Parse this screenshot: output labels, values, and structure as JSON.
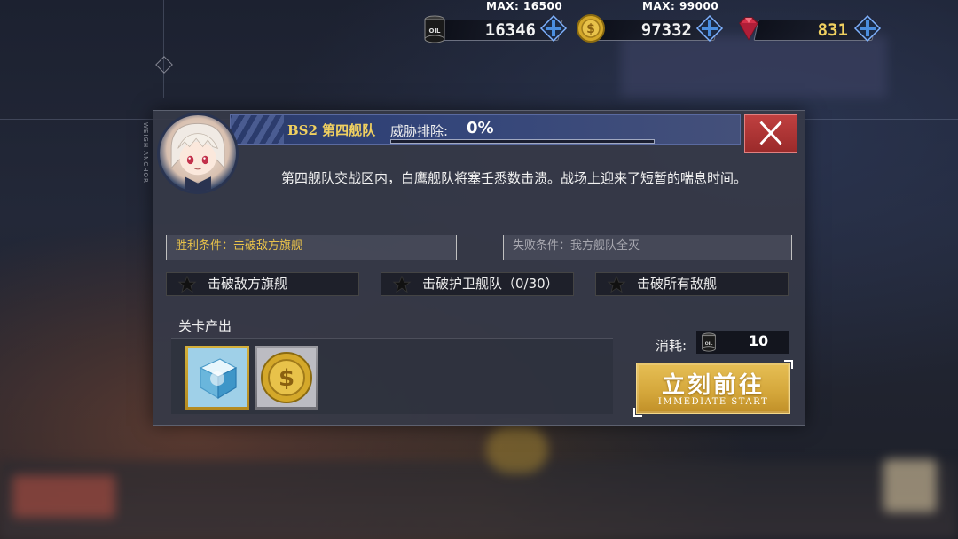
{
  "resources": {
    "oil": {
      "icon": "oil-barrel-icon",
      "value": "16346",
      "max": "MAX: 16500"
    },
    "gold": {
      "icon": "gold-coin-icon",
      "value": "97332",
      "max": "MAX: 99000"
    },
    "gems": {
      "icon": "gem-icon",
      "value": "831"
    }
  },
  "side_label": "WEIGH ANCHOR",
  "stage": {
    "title": "BS2 第四舰队",
    "threat_label": "威胁排除:",
    "threat_value": "0%",
    "threat_progress": 0,
    "description": "第四舰队交战区内，白鹰舰队将塞壬悉数击溃。战场上迎来了短暂的喘息时间。"
  },
  "conditions": {
    "win": "胜利条件：击破敌方旗舰",
    "lose": "失败条件：我方舰队全灭"
  },
  "objectives": [
    {
      "label": "击破敌方旗舰"
    },
    {
      "label": "击破护卫舰队（0/30）"
    },
    {
      "label": "击破所有敌舰"
    }
  ],
  "rewards": {
    "label": "关卡产出",
    "items": [
      "cube-icon",
      "gold-coin-icon"
    ]
  },
  "cost": {
    "label": "消耗:",
    "value": "10",
    "icon": "oil-barrel-icon"
  },
  "start_button": {
    "label": "立刻前往",
    "sublabel": "IMMEDIATE START"
  },
  "colors": {
    "accent_gold": "#e8c24a",
    "close_red": "#b83636",
    "header_blue": "#33457a",
    "plus_blue": "#4a8ee0"
  }
}
